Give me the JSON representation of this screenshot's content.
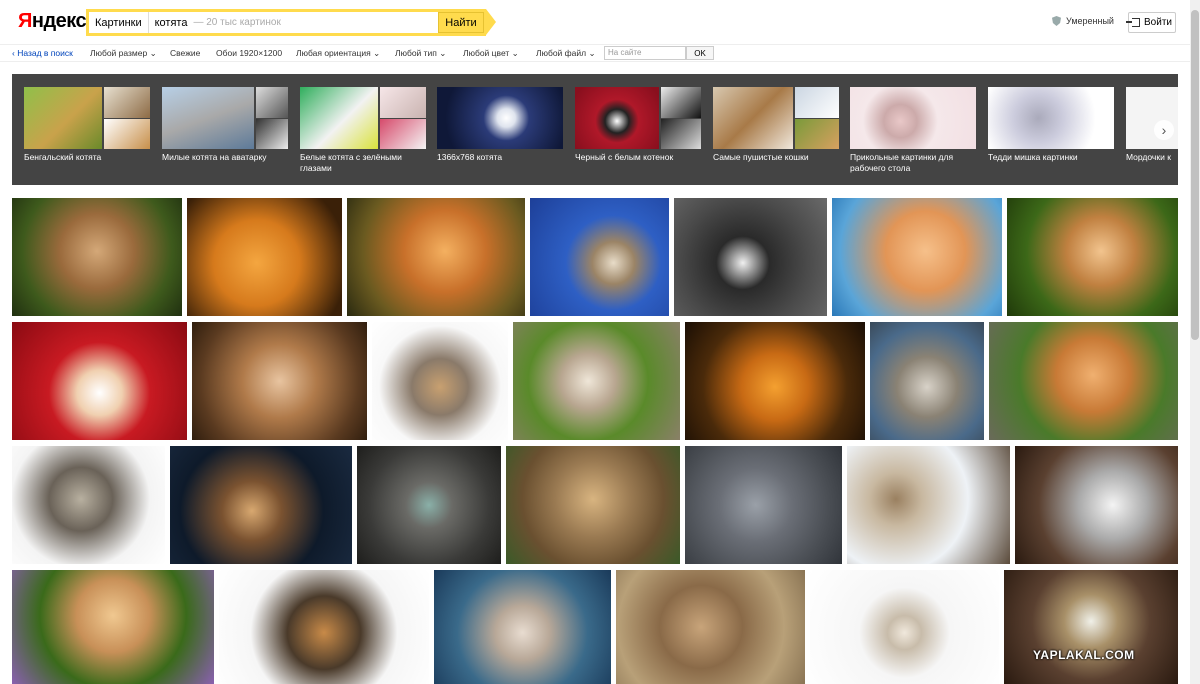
{
  "header": {
    "logo_first": "Я",
    "logo_rest": "ндекс",
    "service_tag": "Картинки",
    "query": "котята",
    "hint": "— 20 тыс картинок",
    "find_label": "Найти",
    "safe_label": "Умеренный",
    "login_label": "Войти"
  },
  "filters": {
    "back": "Назад в поиск",
    "size": "Любой размер",
    "fresh": "Свежие",
    "wallpaper": "Обои 1920×1200",
    "orientation": "Любая ориентация",
    "type": "Любой тип",
    "color": "Любой цвет",
    "file": "Любой файл",
    "site_placeholder": "На сайте",
    "ok": "OK"
  },
  "related": [
    {
      "label": "Бенгальский котята"
    },
    {
      "label": "Милые котята на аватарку"
    },
    {
      "label": "Белые котята с зелёными глазами"
    },
    {
      "label": "1366x768 котята"
    },
    {
      "label": "Черный с белым котенок"
    },
    {
      "label": "Самые пушистые кошки"
    },
    {
      "label": "Прикольные картинки для рабочего стола"
    },
    {
      "label": "Тедди мишка картинки"
    },
    {
      "label": "Мордочки к"
    }
  ],
  "watermark": "YAPLAKAL.COM",
  "colors": {
    "accent_yellow": "#ffdb4d",
    "logo_red": "#ff0000",
    "link_blue": "#0044bb",
    "related_bg": "#444444"
  }
}
